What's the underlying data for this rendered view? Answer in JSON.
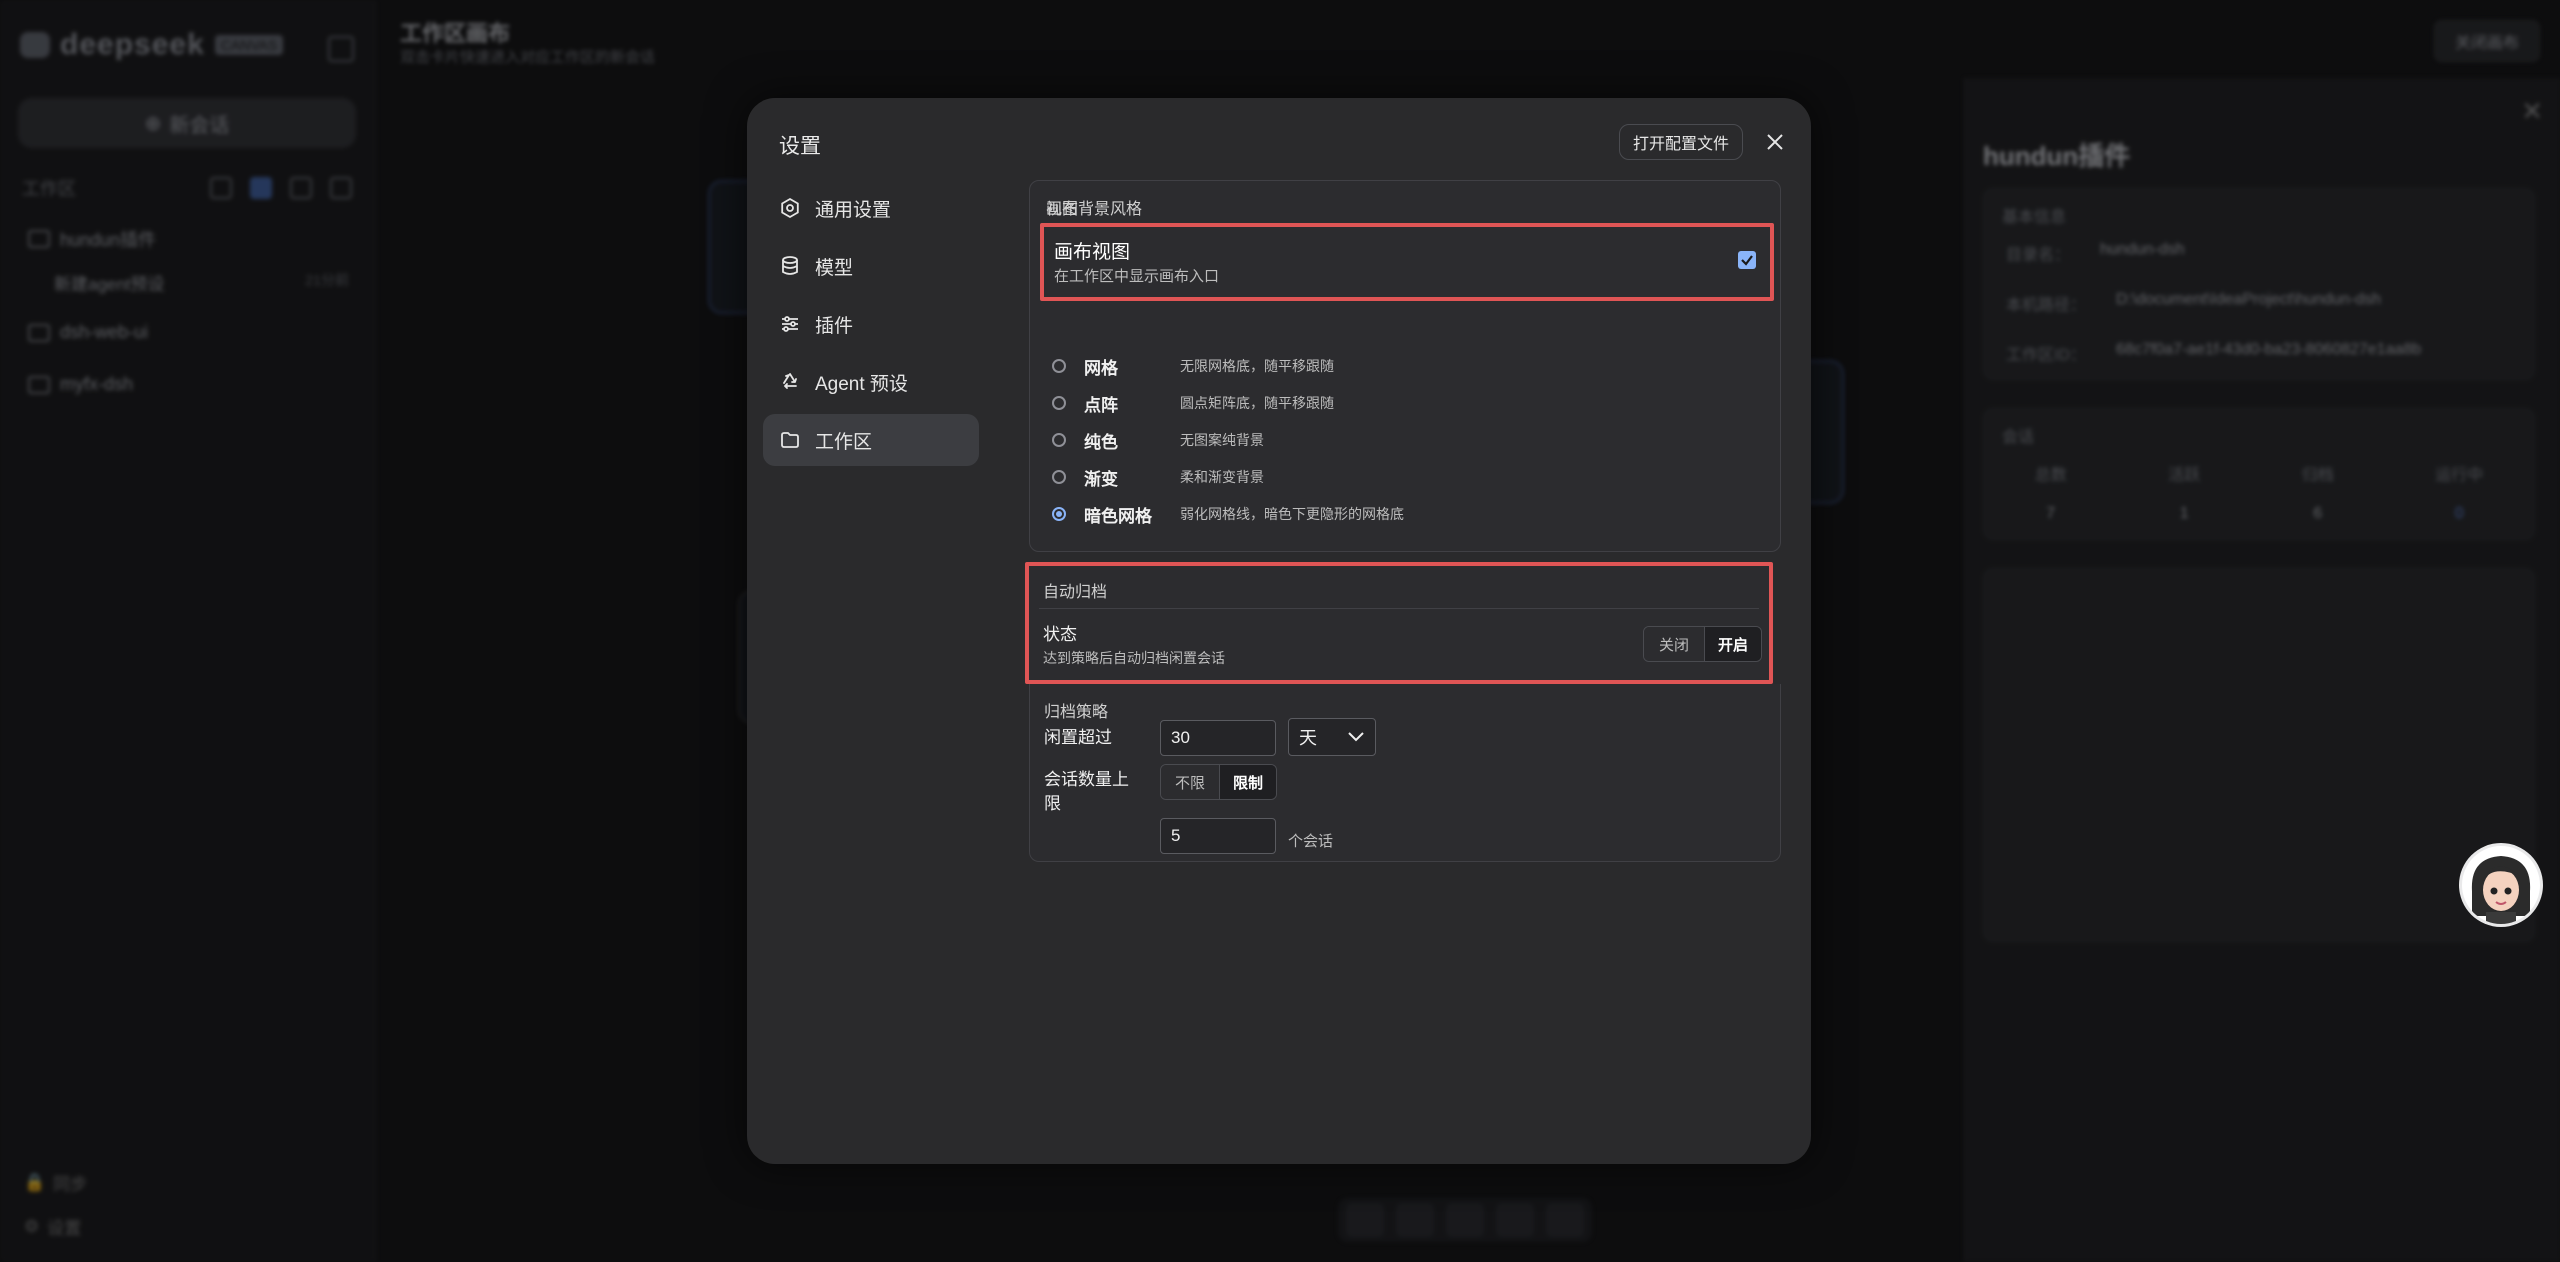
{
  "app": {
    "logo_text": "deepseek",
    "logo_badge": "CANVAS",
    "new_chat": "新会话",
    "workspace_label": "工作区",
    "workspaces": [
      {
        "name": "hundun插件"
      },
      {
        "name": "dsh-web-ui"
      },
      {
        "name": "myfx-dsh"
      }
    ],
    "sub_item": {
      "name": "新建agent预设",
      "time": "21分前"
    },
    "bottom_items": [
      "同步",
      "设置"
    ],
    "canvas_title": "工作区画布",
    "canvas_subtitle": "双击卡片快速进入对应工作区的新会话",
    "exit_canvas": "关闭画布"
  },
  "right_panel": {
    "title": "hundun插件",
    "basic_info_label": "基本信息",
    "basic_info": [
      {
        "key": "目录名：",
        "value": "hundun-dsh"
      },
      {
        "key": "本机路径：",
        "value": "D:\\document\\IdeaProject\\hundun-dsh"
      },
      {
        "key": "工作区ID：",
        "value": "68c7f0a7-ae1f-43d0-ba23-8060827e1aa8b"
      }
    ],
    "sessions_label": "会话",
    "stats": [
      {
        "label": "总数",
        "value": "7"
      },
      {
        "label": "活跃",
        "value": "1"
      },
      {
        "label": "归档",
        "value": "6"
      },
      {
        "label": "运行中",
        "value": "0"
      }
    ]
  },
  "modal": {
    "title": "设置",
    "open_config_label": "打开配置文件",
    "nav": [
      {
        "label": "通用设置",
        "icon": "gear-icon"
      },
      {
        "label": "模型",
        "icon": "database-icon"
      },
      {
        "label": "插件",
        "icon": "sliders-icon"
      },
      {
        "label": "Agent 预设",
        "icon": "recycle-icon"
      },
      {
        "label": "工作区",
        "icon": "folder-icon",
        "active": true
      }
    ],
    "view_section": {
      "label": "视图",
      "canvas_view_title": "画布视图",
      "canvas_view_desc": "在工作区中显示画布入口",
      "canvas_view_checked": true
    },
    "bg_style": {
      "label": "画布背景风格",
      "options": [
        {
          "name": "网格",
          "desc": "无限网格底，随平移跟随"
        },
        {
          "name": "点阵",
          "desc": "圆点矩阵底，随平移跟随"
        },
        {
          "name": "纯色",
          "desc": "无图案纯背景"
        },
        {
          "name": "渐变",
          "desc": "柔和渐变背景"
        },
        {
          "name": "暗色网格",
          "desc": "弱化网格线，暗色下更隐形的网格底"
        }
      ],
      "selected_index": 4
    },
    "auto_archive": {
      "label": "自动归档",
      "state_title": "状态",
      "state_desc": "达到策略后自动归档闲置会话",
      "off_label": "关闭",
      "on_label": "开启",
      "enabled": true
    },
    "policy": {
      "label": "归档策略",
      "idle_label": "闲置超过",
      "idle_value": "30",
      "idle_unit": "天",
      "limit_label": "会话数量上限",
      "unlimited_label": "不限",
      "limit_on_label": "限制",
      "limit_value": "5",
      "limit_unit": "个会话"
    }
  },
  "colors": {
    "accent": "#8ab4f8",
    "highlight_border": "#e05555",
    "modal_bg": "#2a2a2c"
  }
}
